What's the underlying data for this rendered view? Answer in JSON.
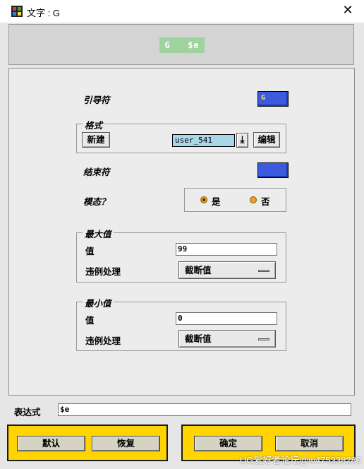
{
  "window": {
    "title": "文字 : G",
    "close_glyph": "✕"
  },
  "preview": {
    "text": "G   $e"
  },
  "leader": {
    "label": "引导符",
    "swatch_text": "G",
    "color": "#3b5ae0"
  },
  "format": {
    "group_title": "格式",
    "new_button": "新建",
    "value": "user_541",
    "download_icon": "⤓",
    "edit_button": "编辑"
  },
  "terminator": {
    "label": "结束符",
    "color": "#3b5ae0"
  },
  "modal": {
    "label": "模态？",
    "yes": "是",
    "no": "否",
    "selected": "yes"
  },
  "max": {
    "group_title": "最大值",
    "value_label": "值",
    "value": "99",
    "violation_label": "违例处理",
    "violation_value": "截断值"
  },
  "min": {
    "group_title": "最小值",
    "value_label": "值",
    "value": "0",
    "violation_label": "违例处理",
    "violation_value": "截断值"
  },
  "expression": {
    "label": "表达式",
    "value": "$e"
  },
  "footer": {
    "default_button": "默认",
    "restore_button": "恢复",
    "ok_button": "确定",
    "cancel_button": "取消"
  },
  "watermark": "UG爱好者论坛@w475338280"
}
